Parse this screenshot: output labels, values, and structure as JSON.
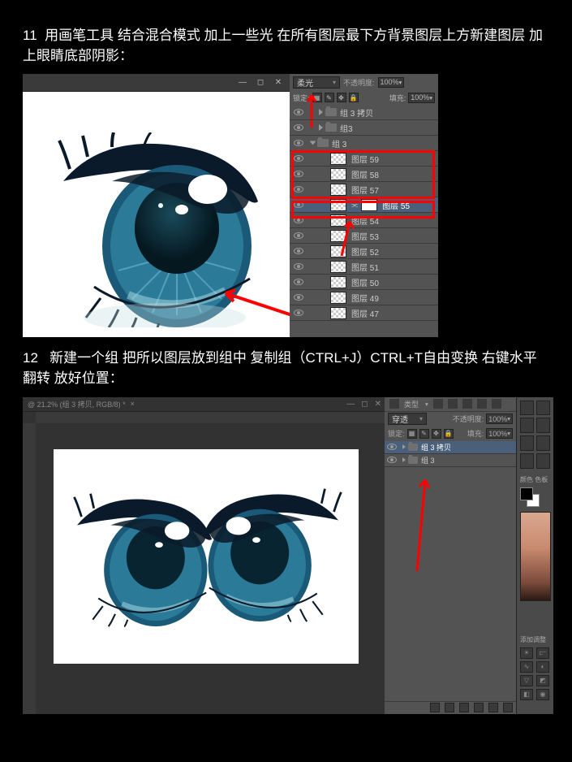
{
  "step1": {
    "num": "11",
    "text": "用画笔工具  结合混合模式  加上一些光  在所有图层最下方背景图层上方新建图层  加上眼睛底部阴影："
  },
  "step2": {
    "num": "12",
    "text": "新建一个组  把所以图层放到组中  复制组（CTRL+J）CTRL+T自由变换  右键水平翻转  放好位置："
  },
  "panel1": {
    "blend_mode": "柔光",
    "opacity_label": "不透明度:",
    "opacity_value": "100%",
    "lock_label": "锁定:",
    "fill_label": "填充:",
    "fill_value": "100%",
    "groups": [
      {
        "name": "组 3 拷贝"
      },
      {
        "name": "组3"
      },
      {
        "name": "组 3"
      }
    ],
    "layers": [
      {
        "name": "图层 59"
      },
      {
        "name": "图层 58"
      },
      {
        "name": "图层 57"
      },
      {
        "name": "图层 55",
        "selected": true
      },
      {
        "name": "图层 54"
      },
      {
        "name": "图层 53"
      },
      {
        "name": "图层 52"
      },
      {
        "name": "图层 51"
      },
      {
        "name": "图层 50"
      },
      {
        "name": "图层 49"
      },
      {
        "name": "图层 47"
      }
    ]
  },
  "fig2": {
    "tab_title": "@ 21.2% (组 3 拷贝, RGB/8) *"
  },
  "panel2": {
    "header": "类型",
    "blend_mode": "穿透",
    "opacity_label": "不透明度:",
    "opacity_value": "100%",
    "lock_label": "锁定:",
    "fill_label": "填充:",
    "fill_value": "100%",
    "layers": [
      {
        "name": "组 3 拷贝",
        "selected": true
      },
      {
        "name": "组 3"
      }
    ]
  },
  "sidebar": {
    "color_label": "颜色 色板",
    "adjust_label": "添加调整",
    "fg_color": "#000000",
    "bg_color": "#ffffff"
  },
  "icons": {
    "brush": "画",
    "link": "⫘"
  }
}
